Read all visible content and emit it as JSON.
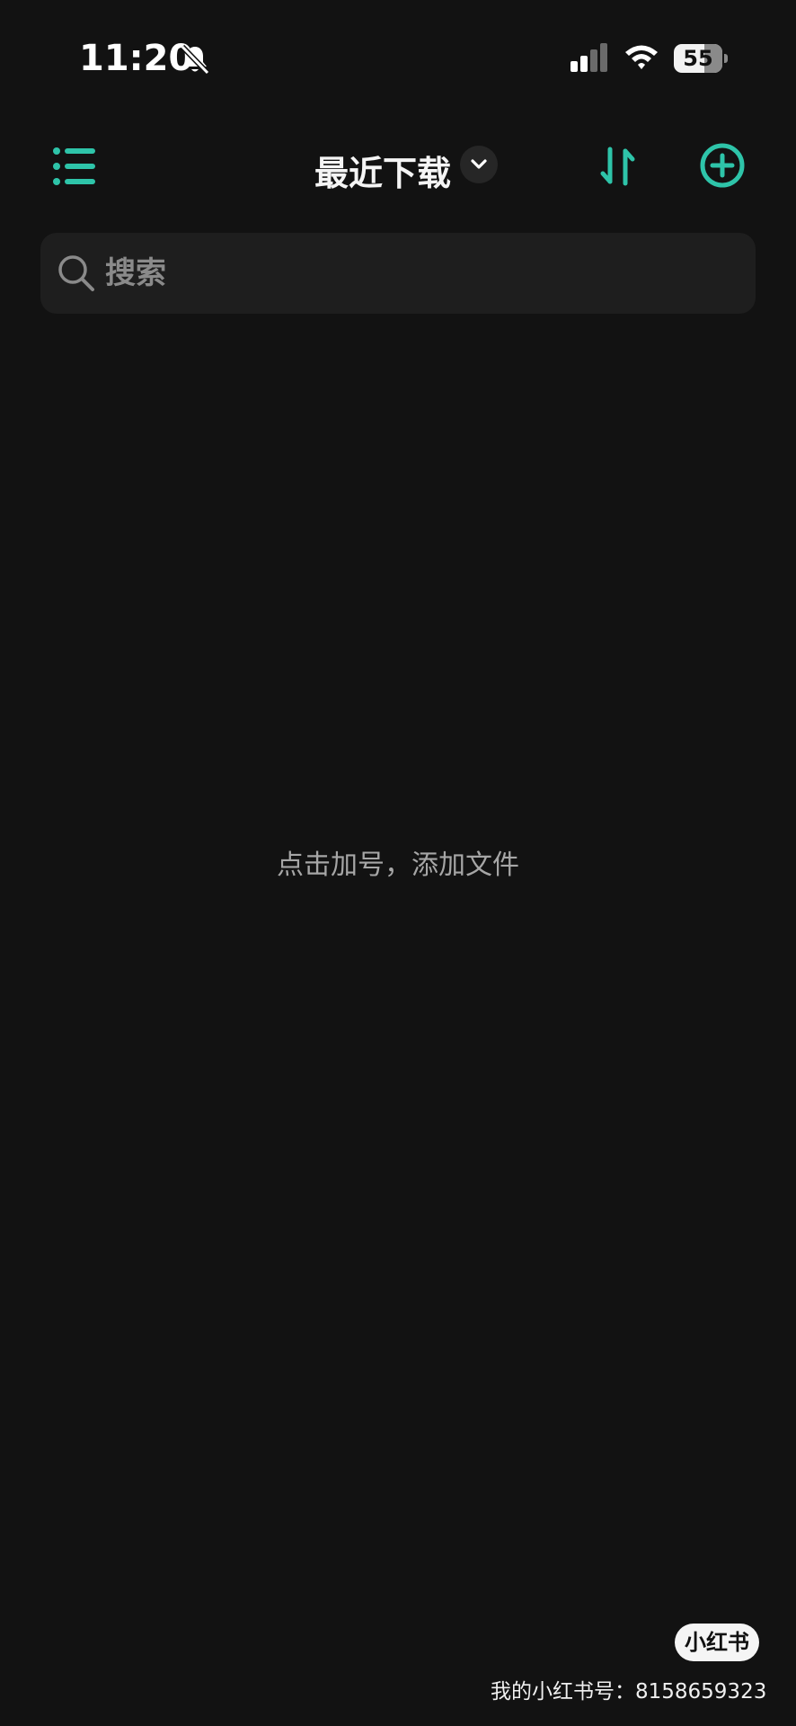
{
  "status_bar": {
    "time": "11:20",
    "battery_level": "55",
    "icons": [
      "bell-off-icon",
      "cellular-signal-icon",
      "wifi-icon",
      "battery-icon"
    ]
  },
  "nav": {
    "title": "最近下载",
    "menu_icon": "list-menu-icon",
    "dropdown_icon": "chevron-down-icon",
    "sort_icon": "sort-arrows-icon",
    "add_icon": "plus-circle-icon"
  },
  "search": {
    "placeholder": "搜索",
    "value": ""
  },
  "empty_state": {
    "hint": "点击加号，添加文件"
  },
  "watermark": {
    "badge": "小红书",
    "text": "我的小红书号：8158659323"
  },
  "colors": {
    "background": "#121212",
    "accent": "#2ec4a9",
    "search_bg": "#1e1e1e",
    "hint_text": "#a6a6a6"
  }
}
